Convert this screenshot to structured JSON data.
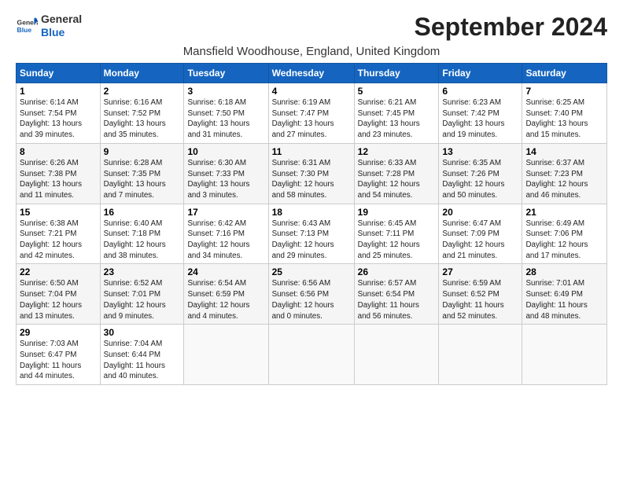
{
  "logo": {
    "line1": "General",
    "line2": "Blue"
  },
  "title": "September 2024",
  "subtitle": "Mansfield Woodhouse, England, United Kingdom",
  "header": {
    "days": [
      "Sunday",
      "Monday",
      "Tuesday",
      "Wednesday",
      "Thursday",
      "Friday",
      "Saturday"
    ]
  },
  "weeks": [
    [
      {
        "num": "1",
        "info": "Sunrise: 6:14 AM\nSunset: 7:54 PM\nDaylight: 13 hours\nand 39 minutes."
      },
      {
        "num": "2",
        "info": "Sunrise: 6:16 AM\nSunset: 7:52 PM\nDaylight: 13 hours\nand 35 minutes."
      },
      {
        "num": "3",
        "info": "Sunrise: 6:18 AM\nSunset: 7:50 PM\nDaylight: 13 hours\nand 31 minutes."
      },
      {
        "num": "4",
        "info": "Sunrise: 6:19 AM\nSunset: 7:47 PM\nDaylight: 13 hours\nand 27 minutes."
      },
      {
        "num": "5",
        "info": "Sunrise: 6:21 AM\nSunset: 7:45 PM\nDaylight: 13 hours\nand 23 minutes."
      },
      {
        "num": "6",
        "info": "Sunrise: 6:23 AM\nSunset: 7:42 PM\nDaylight: 13 hours\nand 19 minutes."
      },
      {
        "num": "7",
        "info": "Sunrise: 6:25 AM\nSunset: 7:40 PM\nDaylight: 13 hours\nand 15 minutes."
      }
    ],
    [
      {
        "num": "8",
        "info": "Sunrise: 6:26 AM\nSunset: 7:38 PM\nDaylight: 13 hours\nand 11 minutes."
      },
      {
        "num": "9",
        "info": "Sunrise: 6:28 AM\nSunset: 7:35 PM\nDaylight: 13 hours\nand 7 minutes."
      },
      {
        "num": "10",
        "info": "Sunrise: 6:30 AM\nSunset: 7:33 PM\nDaylight: 13 hours\nand 3 minutes."
      },
      {
        "num": "11",
        "info": "Sunrise: 6:31 AM\nSunset: 7:30 PM\nDaylight: 12 hours\nand 58 minutes."
      },
      {
        "num": "12",
        "info": "Sunrise: 6:33 AM\nSunset: 7:28 PM\nDaylight: 12 hours\nand 54 minutes."
      },
      {
        "num": "13",
        "info": "Sunrise: 6:35 AM\nSunset: 7:26 PM\nDaylight: 12 hours\nand 50 minutes."
      },
      {
        "num": "14",
        "info": "Sunrise: 6:37 AM\nSunset: 7:23 PM\nDaylight: 12 hours\nand 46 minutes."
      }
    ],
    [
      {
        "num": "15",
        "info": "Sunrise: 6:38 AM\nSunset: 7:21 PM\nDaylight: 12 hours\nand 42 minutes."
      },
      {
        "num": "16",
        "info": "Sunrise: 6:40 AM\nSunset: 7:18 PM\nDaylight: 12 hours\nand 38 minutes."
      },
      {
        "num": "17",
        "info": "Sunrise: 6:42 AM\nSunset: 7:16 PM\nDaylight: 12 hours\nand 34 minutes."
      },
      {
        "num": "18",
        "info": "Sunrise: 6:43 AM\nSunset: 7:13 PM\nDaylight: 12 hours\nand 29 minutes."
      },
      {
        "num": "19",
        "info": "Sunrise: 6:45 AM\nSunset: 7:11 PM\nDaylight: 12 hours\nand 25 minutes."
      },
      {
        "num": "20",
        "info": "Sunrise: 6:47 AM\nSunset: 7:09 PM\nDaylight: 12 hours\nand 21 minutes."
      },
      {
        "num": "21",
        "info": "Sunrise: 6:49 AM\nSunset: 7:06 PM\nDaylight: 12 hours\nand 17 minutes."
      }
    ],
    [
      {
        "num": "22",
        "info": "Sunrise: 6:50 AM\nSunset: 7:04 PM\nDaylight: 12 hours\nand 13 minutes."
      },
      {
        "num": "23",
        "info": "Sunrise: 6:52 AM\nSunset: 7:01 PM\nDaylight: 12 hours\nand 9 minutes."
      },
      {
        "num": "24",
        "info": "Sunrise: 6:54 AM\nSunset: 6:59 PM\nDaylight: 12 hours\nand 4 minutes."
      },
      {
        "num": "25",
        "info": "Sunrise: 6:56 AM\nSunset: 6:56 PM\nDaylight: 12 hours\nand 0 minutes."
      },
      {
        "num": "26",
        "info": "Sunrise: 6:57 AM\nSunset: 6:54 PM\nDaylight: 11 hours\nand 56 minutes."
      },
      {
        "num": "27",
        "info": "Sunrise: 6:59 AM\nSunset: 6:52 PM\nDaylight: 11 hours\nand 52 minutes."
      },
      {
        "num": "28",
        "info": "Sunrise: 7:01 AM\nSunset: 6:49 PM\nDaylight: 11 hours\nand 48 minutes."
      }
    ],
    [
      {
        "num": "29",
        "info": "Sunrise: 7:03 AM\nSunset: 6:47 PM\nDaylight: 11 hours\nand 44 minutes."
      },
      {
        "num": "30",
        "info": "Sunrise: 7:04 AM\nSunset: 6:44 PM\nDaylight: 11 hours\nand 40 minutes."
      },
      {
        "num": "",
        "info": ""
      },
      {
        "num": "",
        "info": ""
      },
      {
        "num": "",
        "info": ""
      },
      {
        "num": "",
        "info": ""
      },
      {
        "num": "",
        "info": ""
      }
    ]
  ]
}
